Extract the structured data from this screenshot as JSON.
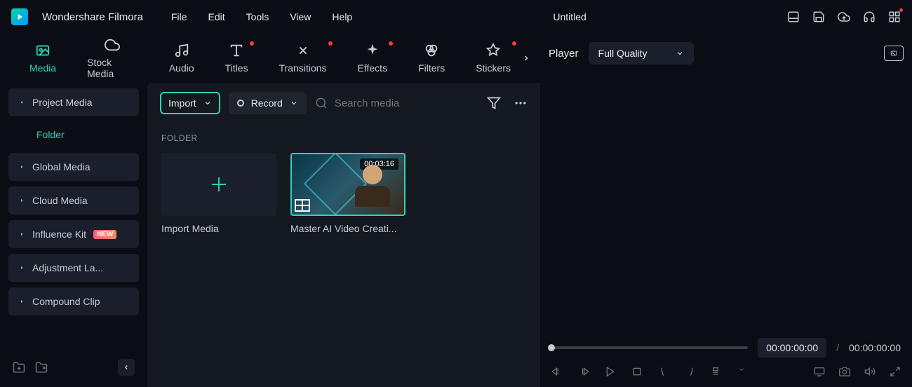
{
  "app": {
    "name": "Wondershare Filmora"
  },
  "menu": {
    "file": "File",
    "edit": "Edit",
    "tools": "Tools",
    "view": "View",
    "help": "Help"
  },
  "document": {
    "title": "Untitled"
  },
  "tabs": {
    "media": "Media",
    "stock": "Stock Media",
    "audio": "Audio",
    "titles": "Titles",
    "transitions": "Transitions",
    "effects": "Effects",
    "filters": "Filters",
    "stickers": "Stickers"
  },
  "sidebar": {
    "project_media": "Project Media",
    "folder": "Folder",
    "global_media": "Global Media",
    "cloud_media": "Cloud Media",
    "influence_kit": "Influence Kit",
    "influence_badge": "NEW",
    "adjustment_layer": "Adjustment La...",
    "compound_clip": "Compound Clip"
  },
  "toolbar": {
    "import": "Import",
    "record": "Record",
    "search_placeholder": "Search media"
  },
  "folder": {
    "heading": "FOLDER",
    "import_card": "Import Media",
    "clip": {
      "duration": "00:03:16",
      "name": "Master AI Video Creati..."
    }
  },
  "player": {
    "label": "Player",
    "quality": "Full Quality",
    "current_tc": "00:00:00:00",
    "total_tc": "00:00:00:00",
    "separator": "/"
  }
}
